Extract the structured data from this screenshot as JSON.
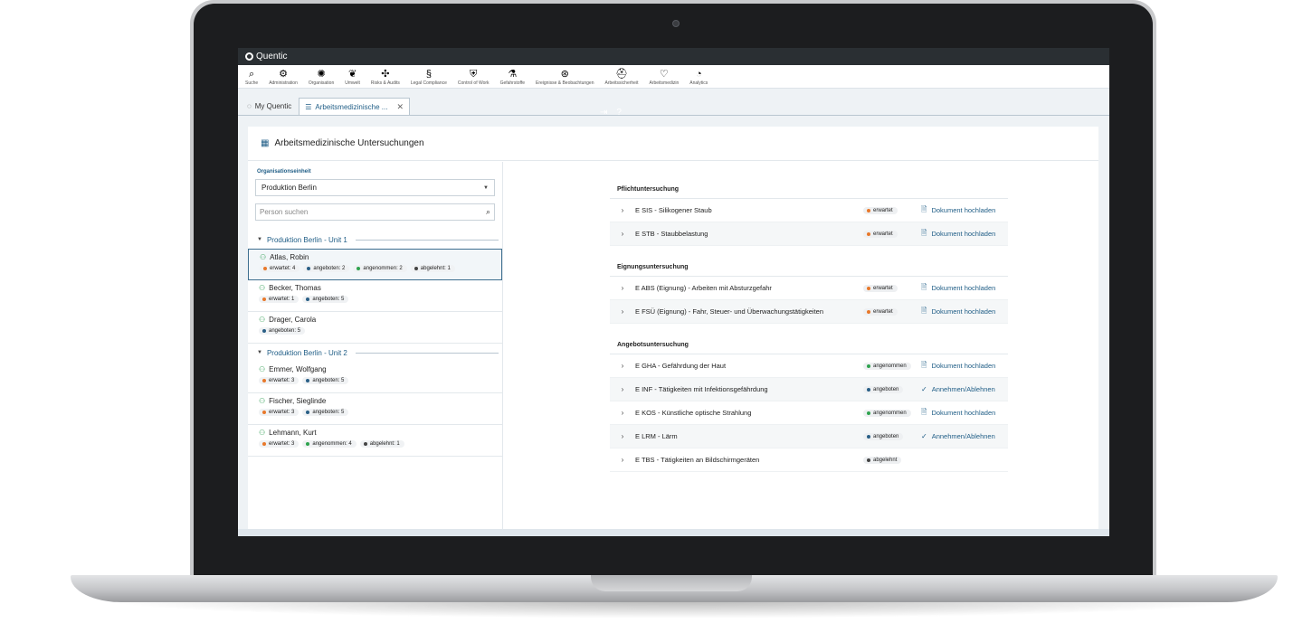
{
  "app": {
    "name": "Quentic"
  },
  "colors": {
    "orange": "#e8782a",
    "blue": "#2a5f86",
    "green": "#2fa34f",
    "dark": "#444444",
    "accent": "#1f5d86"
  },
  "toolbar": [
    {
      "icon": "search-icon",
      "glyph": "⌕",
      "label": "Suche"
    },
    {
      "icon": "gear-icon",
      "glyph": "⚙",
      "label": "Administration"
    },
    {
      "icon": "organisation-icon",
      "glyph": "✺",
      "label": "Organisation"
    },
    {
      "icon": "leaf-icon",
      "glyph": "❦",
      "label": "Umwelt"
    },
    {
      "icon": "risk-icon",
      "glyph": "✣",
      "label": "Risks & Audits"
    },
    {
      "icon": "paragraph-icon",
      "glyph": "§",
      "label": "Legal Compliance"
    },
    {
      "icon": "shield-icon",
      "glyph": "⛨",
      "label": "Control of Work"
    },
    {
      "icon": "flask-icon",
      "glyph": "⚗",
      "label": "Gefahrstoffe"
    },
    {
      "icon": "alert-icon",
      "glyph": "⊛",
      "label": "Ereignisse & Beobachtungen"
    },
    {
      "icon": "helmet-icon",
      "glyph": "⛑",
      "label": "Arbeitssicherheit"
    },
    {
      "icon": "heart-icon",
      "glyph": "♡",
      "label": "Arbeitsmedizin"
    },
    {
      "icon": "analytics-icon",
      "glyph": "◔",
      "label": "Analytics"
    }
  ],
  "tabs": [
    {
      "label": "My Quentic"
    },
    {
      "label": "Arbeitsmedizinische ..."
    }
  ],
  "page": {
    "title": "Arbeitsmedizinische Untersuchungen"
  },
  "filter": {
    "org_label": "Organisationseinheit",
    "org_value": "Produktion Berlin",
    "search_placeholder": "Person suchen"
  },
  "groups": [
    {
      "name": "Produktion Berlin - Unit 1",
      "people": [
        {
          "name": "Atlas, Robin",
          "badges": [
            {
              "text": "erwartet: 4",
              "color": "#e8782a"
            },
            {
              "text": "angeboten: 2",
              "color": "#2a5f86"
            },
            {
              "text": "angenommen: 2",
              "color": "#2fa34f"
            },
            {
              "text": "abgelehnt: 1",
              "color": "#444444"
            }
          ]
        },
        {
          "name": "Becker, Thomas",
          "badges": [
            {
              "text": "erwartet: 1",
              "color": "#e8782a"
            },
            {
              "text": "angeboten: 5",
              "color": "#2a5f86"
            }
          ]
        },
        {
          "name": "Drager, Carola",
          "badges": [
            {
              "text": "angeboten: 5",
              "color": "#2a5f86"
            }
          ]
        }
      ]
    },
    {
      "name": "Produktion Berlin - Unit 2",
      "people": [
        {
          "name": "Emmer, Wolfgang",
          "badges": [
            {
              "text": "erwartet: 3",
              "color": "#e8782a"
            },
            {
              "text": "angeboten: 5",
              "color": "#2a5f86"
            }
          ]
        },
        {
          "name": "Fischer, Sieglinde",
          "badges": [
            {
              "text": "erwartet: 3",
              "color": "#e8782a"
            },
            {
              "text": "angeboten: 5",
              "color": "#2a5f86"
            }
          ]
        },
        {
          "name": "Lehmann, Kurt",
          "badges": [
            {
              "text": "erwartet: 3",
              "color": "#e8782a"
            },
            {
              "text": "angenommen: 4",
              "color": "#2fa34f"
            },
            {
              "text": "abgelehnt: 1",
              "color": "#444444"
            }
          ]
        }
      ]
    }
  ],
  "sections": [
    {
      "title": "Pflichtuntersuchung",
      "exams": [
        {
          "title": "E SIS - Silikogener Staub",
          "status": "erwartet",
          "status_color": "#e8782a",
          "action": "Dokument hochladen",
          "action_icon": "document-upload-icon",
          "action_glyph": "🗎"
        },
        {
          "title": "E STB - Staubbelastung",
          "status": "erwartet",
          "status_color": "#e8782a",
          "action": "Dokument hochladen",
          "action_icon": "document-upload-icon",
          "action_glyph": "🗎"
        }
      ]
    },
    {
      "title": "Eignungsuntersuchung",
      "exams": [
        {
          "title": "E ABS (Eignung) - Arbeiten mit Absturzgefahr",
          "status": "erwartet",
          "status_color": "#e8782a",
          "action": "Dokument hochladen",
          "action_icon": "document-upload-icon",
          "action_glyph": "🗎"
        },
        {
          "title": "E FSÜ (Eignung) - Fahr, Steuer- und Überwachungstätigkeiten",
          "status": "erwartet",
          "status_color": "#e8782a",
          "action": "Dokument hochladen",
          "action_icon": "document-upload-icon",
          "action_glyph": "🗎"
        }
      ]
    },
    {
      "title": "Angebotsuntersuchung",
      "exams": [
        {
          "title": "E GHA - Gefährdung der Haut",
          "status": "angenommen",
          "status_color": "#2fa34f",
          "action": "Dokument hochladen",
          "action_icon": "document-upload-icon",
          "action_glyph": "🗎"
        },
        {
          "title": "E INF - Tätigkeiten mit Infektionsgefährdung",
          "status": "angeboten",
          "status_color": "#2a5f86",
          "action": "Annehmen/Ablehnen",
          "action_icon": "check-circle-icon",
          "action_glyph": "✓"
        },
        {
          "title": "E KOS - Künstliche optische Strahlung",
          "status": "angenommen",
          "status_color": "#2fa34f",
          "action": "Dokument hochladen",
          "action_icon": "document-upload-icon",
          "action_glyph": "🗎"
        },
        {
          "title": "E LRM - Lärm",
          "status": "angeboten",
          "status_color": "#2a5f86",
          "action": "Annehmen/Ablehnen",
          "action_icon": "check-circle-icon",
          "action_glyph": "✓"
        },
        {
          "title": "E TBS - Tätigkeiten an Bildschirmgeräten",
          "status": "abgelehnt",
          "status_color": "#444444",
          "action": "",
          "action_icon": "",
          "action_glyph": ""
        }
      ]
    }
  ]
}
